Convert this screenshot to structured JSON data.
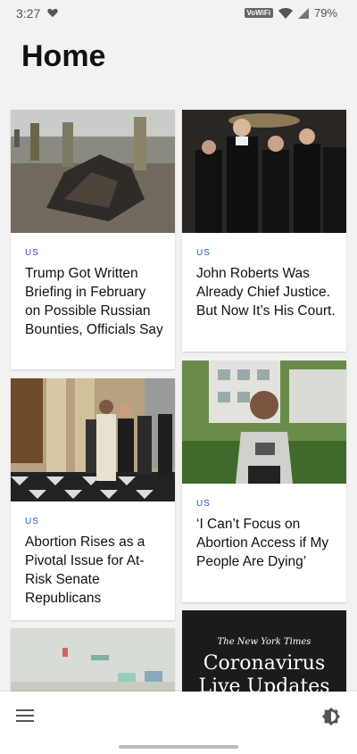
{
  "status": {
    "time": "3:27",
    "vowifi": "VoWiFi",
    "battery": "79%"
  },
  "page": {
    "title": "Home"
  },
  "cards": [
    {
      "section": "US",
      "headline": "Trump Got Written Briefing in February on Possible Russian Bounties, Officials Say"
    },
    {
      "section": "US",
      "headline": "John Roberts Was Already Chief Justice. But Now It’s His Court."
    },
    {
      "section": "US",
      "headline": "Abortion Rises as a Pivotal Issue for At-Risk Senate Republicans"
    },
    {
      "section": "US",
      "headline": "‘I Can’t Focus on Abortion Access if My People Are Dying’"
    }
  ],
  "promo": {
    "brand": "The New York Times",
    "headline": "Coronavirus Live Updates"
  },
  "icons": {
    "menu": "menu-icon",
    "theme": "brightness-icon",
    "heart": "heart-icon"
  }
}
